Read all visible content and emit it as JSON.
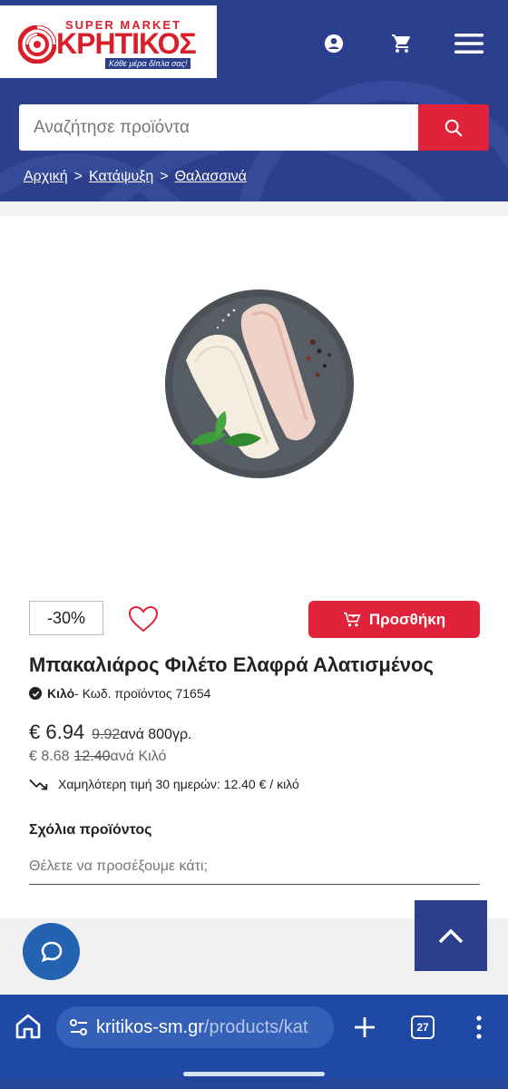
{
  "brand": {
    "super_market": "SUPER MARKET",
    "name": "ΚΡΗΤΙΚΟΣ",
    "tagline": "Κάθε μέρα δίπλα σας!"
  },
  "header": {
    "account_icon": "account-icon",
    "cart_icon": "cart-icon",
    "menu_icon": "hamburger-menu-icon"
  },
  "search": {
    "placeholder": "Αναζήτησε προϊόντα",
    "button_icon": "search-icon"
  },
  "breadcrumb": {
    "items": [
      "Αρχική",
      "Κατάψυξη",
      "Θαλασσινά"
    ],
    "separator": ">"
  },
  "product": {
    "discount": "-30%",
    "add_button": "Προσθήκη",
    "title": "Μπακαλιάρος Φιλέτο Ελαφρά Αλατισμένος",
    "unit_label": "Κιλό",
    "code_text": "- Κωδ. προϊόντος 71654",
    "price": "€ 6.94",
    "price_old": "9.92 ",
    "price_unit": "ανά 800γρ.",
    "kilo_price": "€ 8.68",
    "kilo_price_old": "12.40 ",
    "kilo_unit": "ανά Κιλό",
    "lowest_price": "Χαμηλότερη τιμή 30 ημερών: 12.40 € / κιλό"
  },
  "comments": {
    "title": "Σχόλια προϊόντος",
    "placeholder": "Θέλετε να προσέξουμε κάτι;"
  },
  "browser": {
    "url_host": "kritikos-sm.gr",
    "url_path": "/products/kat",
    "tab_count": "27"
  },
  "colors": {
    "brand_blue": "#2c3f8c",
    "brand_red": "#e0233a",
    "chat_blue": "#2363b2",
    "browser_blue": "#1e4aa6"
  }
}
